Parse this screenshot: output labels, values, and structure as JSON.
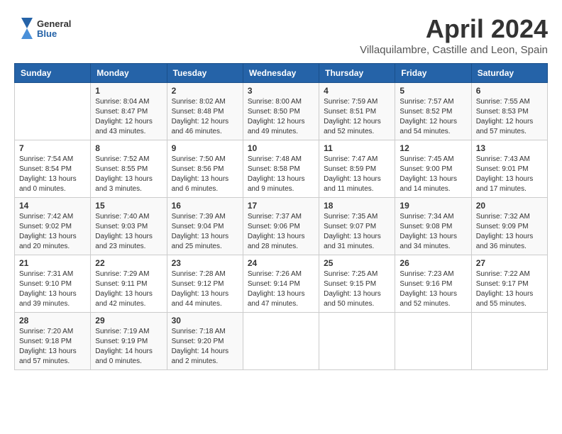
{
  "header": {
    "logo_line1": "General",
    "logo_line2": "Blue",
    "month": "April 2024",
    "location": "Villaquilambre, Castille and Leon, Spain"
  },
  "weekdays": [
    "Sunday",
    "Monday",
    "Tuesday",
    "Wednesday",
    "Thursday",
    "Friday",
    "Saturday"
  ],
  "weeks": [
    [
      {
        "day": "",
        "sunrise": "",
        "sunset": "",
        "daylight": ""
      },
      {
        "day": "1",
        "sunrise": "Sunrise: 8:04 AM",
        "sunset": "Sunset: 8:47 PM",
        "daylight": "Daylight: 12 hours and 43 minutes."
      },
      {
        "day": "2",
        "sunrise": "Sunrise: 8:02 AM",
        "sunset": "Sunset: 8:48 PM",
        "daylight": "Daylight: 12 hours and 46 minutes."
      },
      {
        "day": "3",
        "sunrise": "Sunrise: 8:00 AM",
        "sunset": "Sunset: 8:50 PM",
        "daylight": "Daylight: 12 hours and 49 minutes."
      },
      {
        "day": "4",
        "sunrise": "Sunrise: 7:59 AM",
        "sunset": "Sunset: 8:51 PM",
        "daylight": "Daylight: 12 hours and 52 minutes."
      },
      {
        "day": "5",
        "sunrise": "Sunrise: 7:57 AM",
        "sunset": "Sunset: 8:52 PM",
        "daylight": "Daylight: 12 hours and 54 minutes."
      },
      {
        "day": "6",
        "sunrise": "Sunrise: 7:55 AM",
        "sunset": "Sunset: 8:53 PM",
        "daylight": "Daylight: 12 hours and 57 minutes."
      }
    ],
    [
      {
        "day": "7",
        "sunrise": "Sunrise: 7:54 AM",
        "sunset": "Sunset: 8:54 PM",
        "daylight": "Daylight: 13 hours and 0 minutes."
      },
      {
        "day": "8",
        "sunrise": "Sunrise: 7:52 AM",
        "sunset": "Sunset: 8:55 PM",
        "daylight": "Daylight: 13 hours and 3 minutes."
      },
      {
        "day": "9",
        "sunrise": "Sunrise: 7:50 AM",
        "sunset": "Sunset: 8:56 PM",
        "daylight": "Daylight: 13 hours and 6 minutes."
      },
      {
        "day": "10",
        "sunrise": "Sunrise: 7:48 AM",
        "sunset": "Sunset: 8:58 PM",
        "daylight": "Daylight: 13 hours and 9 minutes."
      },
      {
        "day": "11",
        "sunrise": "Sunrise: 7:47 AM",
        "sunset": "Sunset: 8:59 PM",
        "daylight": "Daylight: 13 hours and 11 minutes."
      },
      {
        "day": "12",
        "sunrise": "Sunrise: 7:45 AM",
        "sunset": "Sunset: 9:00 PM",
        "daylight": "Daylight: 13 hours and 14 minutes."
      },
      {
        "day": "13",
        "sunrise": "Sunrise: 7:43 AM",
        "sunset": "Sunset: 9:01 PM",
        "daylight": "Daylight: 13 hours and 17 minutes."
      }
    ],
    [
      {
        "day": "14",
        "sunrise": "Sunrise: 7:42 AM",
        "sunset": "Sunset: 9:02 PM",
        "daylight": "Daylight: 13 hours and 20 minutes."
      },
      {
        "day": "15",
        "sunrise": "Sunrise: 7:40 AM",
        "sunset": "Sunset: 9:03 PM",
        "daylight": "Daylight: 13 hours and 23 minutes."
      },
      {
        "day": "16",
        "sunrise": "Sunrise: 7:39 AM",
        "sunset": "Sunset: 9:04 PM",
        "daylight": "Daylight: 13 hours and 25 minutes."
      },
      {
        "day": "17",
        "sunrise": "Sunrise: 7:37 AM",
        "sunset": "Sunset: 9:06 PM",
        "daylight": "Daylight: 13 hours and 28 minutes."
      },
      {
        "day": "18",
        "sunrise": "Sunrise: 7:35 AM",
        "sunset": "Sunset: 9:07 PM",
        "daylight": "Daylight: 13 hours and 31 minutes."
      },
      {
        "day": "19",
        "sunrise": "Sunrise: 7:34 AM",
        "sunset": "Sunset: 9:08 PM",
        "daylight": "Daylight: 13 hours and 34 minutes."
      },
      {
        "day": "20",
        "sunrise": "Sunrise: 7:32 AM",
        "sunset": "Sunset: 9:09 PM",
        "daylight": "Daylight: 13 hours and 36 minutes."
      }
    ],
    [
      {
        "day": "21",
        "sunrise": "Sunrise: 7:31 AM",
        "sunset": "Sunset: 9:10 PM",
        "daylight": "Daylight: 13 hours and 39 minutes."
      },
      {
        "day": "22",
        "sunrise": "Sunrise: 7:29 AM",
        "sunset": "Sunset: 9:11 PM",
        "daylight": "Daylight: 13 hours and 42 minutes."
      },
      {
        "day": "23",
        "sunrise": "Sunrise: 7:28 AM",
        "sunset": "Sunset: 9:12 PM",
        "daylight": "Daylight: 13 hours and 44 minutes."
      },
      {
        "day": "24",
        "sunrise": "Sunrise: 7:26 AM",
        "sunset": "Sunset: 9:14 PM",
        "daylight": "Daylight: 13 hours and 47 minutes."
      },
      {
        "day": "25",
        "sunrise": "Sunrise: 7:25 AM",
        "sunset": "Sunset: 9:15 PM",
        "daylight": "Daylight: 13 hours and 50 minutes."
      },
      {
        "day": "26",
        "sunrise": "Sunrise: 7:23 AM",
        "sunset": "Sunset: 9:16 PM",
        "daylight": "Daylight: 13 hours and 52 minutes."
      },
      {
        "day": "27",
        "sunrise": "Sunrise: 7:22 AM",
        "sunset": "Sunset: 9:17 PM",
        "daylight": "Daylight: 13 hours and 55 minutes."
      }
    ],
    [
      {
        "day": "28",
        "sunrise": "Sunrise: 7:20 AM",
        "sunset": "Sunset: 9:18 PM",
        "daylight": "Daylight: 13 hours and 57 minutes."
      },
      {
        "day": "29",
        "sunrise": "Sunrise: 7:19 AM",
        "sunset": "Sunset: 9:19 PM",
        "daylight": "Daylight: 14 hours and 0 minutes."
      },
      {
        "day": "30",
        "sunrise": "Sunrise: 7:18 AM",
        "sunset": "Sunset: 9:20 PM",
        "daylight": "Daylight: 14 hours and 2 minutes."
      },
      {
        "day": "",
        "sunrise": "",
        "sunset": "",
        "daylight": ""
      },
      {
        "day": "",
        "sunrise": "",
        "sunset": "",
        "daylight": ""
      },
      {
        "day": "",
        "sunrise": "",
        "sunset": "",
        "daylight": ""
      },
      {
        "day": "",
        "sunrise": "",
        "sunset": "",
        "daylight": ""
      }
    ]
  ]
}
